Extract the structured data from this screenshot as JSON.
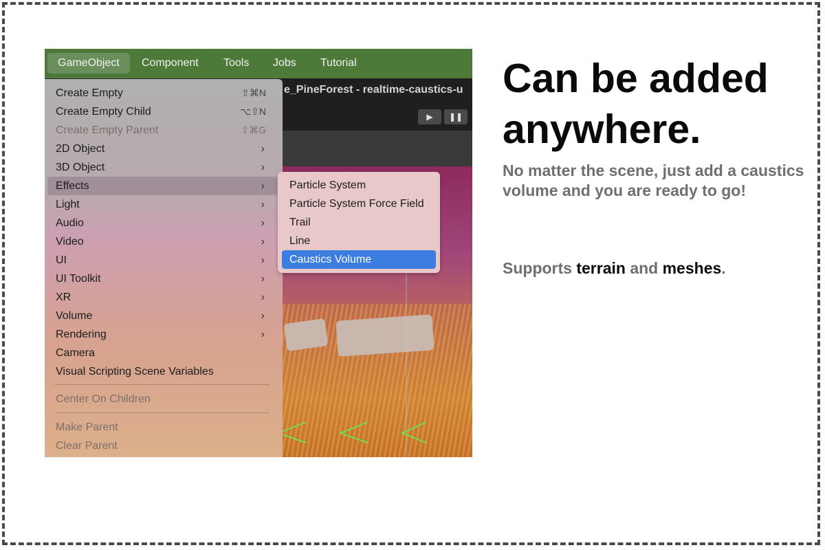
{
  "menubar": {
    "items": [
      "GameObject",
      "Component",
      "Tools",
      "Jobs",
      "Tutorial"
    ]
  },
  "editor": {
    "window_title": "e_PineForest - realtime-caustics-u",
    "play_icon": "▶",
    "pause_icon": "❚❚"
  },
  "gameobject_menu": {
    "items": [
      {
        "label": "Create Empty",
        "shortcut": "⇧⌘N"
      },
      {
        "label": "Create Empty Child",
        "shortcut": "⌥⇧N"
      },
      {
        "label": "Create Empty Parent",
        "shortcut": "⇧⌘G",
        "disabled": true
      },
      {
        "label": "2D Object",
        "submenu": true
      },
      {
        "label": "3D Object",
        "submenu": true
      },
      {
        "label": "Effects",
        "submenu": true,
        "highlighted": true
      },
      {
        "label": "Light",
        "submenu": true
      },
      {
        "label": "Audio",
        "submenu": true
      },
      {
        "label": "Video",
        "submenu": true
      },
      {
        "label": "UI",
        "submenu": true
      },
      {
        "label": "UI Toolkit",
        "submenu": true
      },
      {
        "label": "XR",
        "submenu": true
      },
      {
        "label": "Volume",
        "submenu": true
      },
      {
        "label": "Rendering",
        "submenu": true
      },
      {
        "label": "Camera"
      },
      {
        "label": "Visual Scripting Scene Variables"
      },
      {
        "label": "Center On Children",
        "disabled": true
      },
      {
        "label": "Make Parent",
        "disabled": true
      },
      {
        "label": "Clear Parent",
        "disabled": true
      }
    ],
    "arrow_glyph": "›"
  },
  "effects_submenu": {
    "items": [
      "Particle System",
      "Particle System Force Field",
      "Trail",
      "Line",
      "Caustics Volume"
    ],
    "selected": "Caustics Volume"
  },
  "promo": {
    "heading": "Can be added anywhere.",
    "description": "No matter the scene, just add a caustics volume and you are ready to go!",
    "supports_prefix": "Supports ",
    "supports_term1": "terrain",
    "supports_middle": " and ",
    "supports_term2": "meshes",
    "supports_suffix": "."
  },
  "colors": {
    "menubar": "#4d7a39",
    "selection": "#3c7ee0"
  }
}
